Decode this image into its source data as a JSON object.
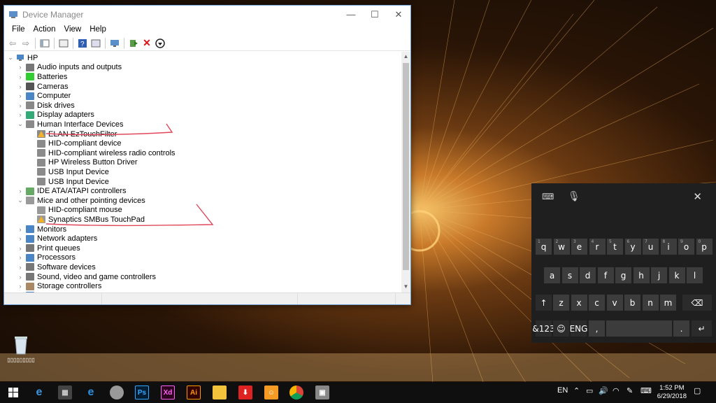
{
  "window": {
    "title": "Device Manager",
    "menu": [
      "File",
      "Action",
      "View",
      "Help"
    ]
  },
  "tree": {
    "root": "HP",
    "items": [
      {
        "label": "Audio inputs and outputs",
        "level": 1,
        "expanded": false,
        "icon": "speaker-icon"
      },
      {
        "label": "Batteries",
        "level": 1,
        "expanded": false,
        "icon": "battery-icon"
      },
      {
        "label": "Cameras",
        "level": 1,
        "expanded": false,
        "icon": "camera-icon"
      },
      {
        "label": "Computer",
        "level": 1,
        "expanded": false,
        "icon": "monitor-icon"
      },
      {
        "label": "Disk drives",
        "level": 1,
        "expanded": false,
        "icon": "disk-icon"
      },
      {
        "label": "Display adapters",
        "level": 1,
        "expanded": false,
        "icon": "display-adapter-icon"
      },
      {
        "label": "Human Interface Devices",
        "level": 1,
        "expanded": true,
        "icon": "hid-icon"
      },
      {
        "label": "ELAN EzTouchFilter",
        "level": 2,
        "warning": true,
        "icon": "hid-icon"
      },
      {
        "label": "HID-compliant device",
        "level": 2,
        "icon": "hid-icon"
      },
      {
        "label": "HID-compliant wireless radio controls",
        "level": 2,
        "icon": "hid-icon"
      },
      {
        "label": "HP Wireless Button Driver",
        "level": 2,
        "icon": "hid-icon"
      },
      {
        "label": "USB Input Device",
        "level": 2,
        "icon": "hid-icon"
      },
      {
        "label": "USB Input Device",
        "level": 2,
        "icon": "hid-icon"
      },
      {
        "label": "IDE ATA/ATAPI controllers",
        "level": 1,
        "expanded": false,
        "icon": "controller-icon"
      },
      {
        "label": "Mice and other pointing devices",
        "level": 1,
        "expanded": true,
        "icon": "mouse-icon"
      },
      {
        "label": "HID-compliant mouse",
        "level": 2,
        "icon": "mouse-icon"
      },
      {
        "label": "Synaptics SMBus TouchPad",
        "level": 2,
        "warning": true,
        "icon": "mouse-icon"
      },
      {
        "label": "Monitors",
        "level": 1,
        "expanded": false,
        "icon": "monitor-icon"
      },
      {
        "label": "Network adapters",
        "level": 1,
        "expanded": false,
        "icon": "network-icon"
      },
      {
        "label": "Print queues",
        "level": 1,
        "expanded": false,
        "icon": "printer-icon"
      },
      {
        "label": "Processors",
        "level": 1,
        "expanded": false,
        "icon": "processor-icon"
      },
      {
        "label": "Software devices",
        "level": 1,
        "expanded": false,
        "icon": "software-icon"
      },
      {
        "label": "Sound, video and game controllers",
        "level": 1,
        "expanded": false,
        "icon": "speaker-icon"
      },
      {
        "label": "Storage controllers",
        "level": 1,
        "expanded": false,
        "icon": "storage-icon"
      },
      {
        "label": "System devices",
        "level": 1,
        "expanded": false,
        "icon": "system-icon"
      }
    ]
  },
  "keyboard": {
    "row1": [
      {
        "k": "q",
        "n": "1"
      },
      {
        "k": "w",
        "n": "2"
      },
      {
        "k": "e",
        "n": "3"
      },
      {
        "k": "r",
        "n": "4"
      },
      {
        "k": "t",
        "n": "5"
      },
      {
        "k": "y",
        "n": "6"
      },
      {
        "k": "u",
        "n": "7"
      },
      {
        "k": "i",
        "n": "8"
      },
      {
        "k": "o",
        "n": "9"
      },
      {
        "k": "p",
        "n": "0"
      }
    ],
    "row2": [
      "a",
      "s",
      "d",
      "f",
      "g",
      "h",
      "j",
      "k",
      "l"
    ],
    "row3": [
      "z",
      "x",
      "c",
      "v",
      "b",
      "n",
      "m"
    ],
    "shift": "↑",
    "backspace": "⌫",
    "symbols": "&123",
    "emoji": "☺",
    "lang": "ENG",
    "comma": ",",
    "period": ".",
    "enter": "↵",
    "close": "✕"
  },
  "taskbar": {
    "lang": "EN",
    "time": "1:52 PM",
    "date": "6/29/2018",
    "apps": [
      "Ps",
      "Xd",
      "Ai"
    ]
  },
  "desktop": {
    "recycle_label": "▯▯▯▯▯▯▯▯▯"
  },
  "colors": {
    "annotation": "#e0475a",
    "warning": "#f2b02b"
  }
}
